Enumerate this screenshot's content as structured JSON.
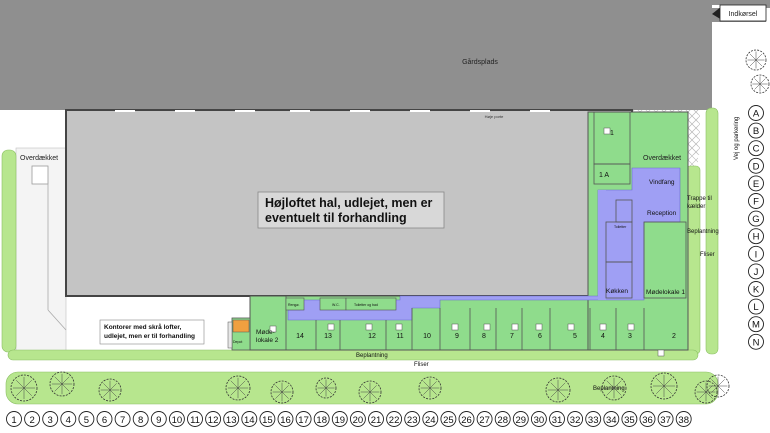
{
  "labels": {
    "indkorsel": "Indkørsel",
    "gardsplads": "Gårdsplads",
    "hoje_port": "Høje porte",
    "overdaekket_left": "Overdækket",
    "overdaekket_right": "Overdækket",
    "hall_line1": "Højloftet hal, udlejet, men er",
    "hall_line2": "eventuelt til forhandling",
    "kontorer_line1": "Kontorer med skrå lofter,",
    "kontorer_line2": "udlejet, men er til forhandling",
    "vindfang": "Vindfang",
    "reception": "Reception",
    "trappe_line1": "Trappe til",
    "trappe_line2": "kælder",
    "beplantning_right": "Beplantning",
    "fliser_right": "Fliser",
    "kokken": "Køkken",
    "modelokale1": "Mødelokale 1",
    "modelokale2_line1": "Møde-",
    "modelokale2_line2": "lokale 2",
    "beplantning_bottom": "Beplantning",
    "fliser_bottom": "Fliser",
    "beplantning_lower": "Beplantning",
    "vej": "Vej og parkering",
    "toilet": "Toiletter",
    "toilet_bad": "Toiletter og bad",
    "rengoring": "Rengø.",
    "wc": "W.C.",
    "depot": "Depot"
  },
  "rooms": [
    "1",
    "1 A",
    "2",
    "3",
    "4",
    "5",
    "6",
    "7",
    "8",
    "9",
    "10",
    "11",
    "12",
    "13",
    "14"
  ],
  "grid_columns": [
    "1",
    "2",
    "3",
    "4",
    "5",
    "6",
    "7",
    "8",
    "9",
    "10",
    "11",
    "12",
    "13",
    "14",
    "15",
    "16",
    "17",
    "18",
    "19",
    "20",
    "21",
    "22",
    "23",
    "24",
    "25",
    "26",
    "27",
    "28",
    "29",
    "30",
    "31",
    "32",
    "33",
    "34",
    "35",
    "36",
    "37",
    "38"
  ],
  "grid_rows": [
    "A",
    "B",
    "C",
    "D",
    "E",
    "F",
    "G",
    "H",
    "I",
    "J",
    "K",
    "L",
    "M",
    "N"
  ],
  "colors": {
    "asphalt": "#8f8f8f",
    "hall": "#c4c4c4",
    "office": "#8fdc8c",
    "corridor": "#9f9ff4",
    "grass": "#b7e68e"
  }
}
